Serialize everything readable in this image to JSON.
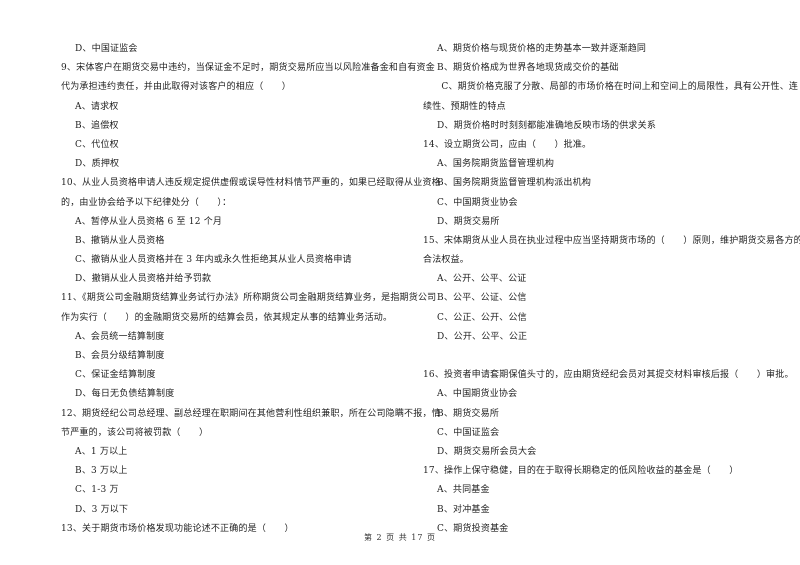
{
  "page": {
    "footer": "第 2 页 共 17 页"
  },
  "left_column": [
    {
      "type": "option",
      "text": "D、中国证监会"
    },
    {
      "type": "question",
      "number": "9",
      "lines": [
        "9、宋体客户在期货交易中违约，当保证金不足时，期货交易所应当以风险准备金和自有资金",
        "代为承担违约责任，并由此取得对该客户的相应（　　）"
      ]
    },
    {
      "type": "option",
      "text": "A、请求权"
    },
    {
      "type": "option",
      "text": "B、追偿权"
    },
    {
      "type": "option",
      "text": "C、代位权"
    },
    {
      "type": "option",
      "text": "D、质押权"
    },
    {
      "type": "question",
      "number": "10",
      "lines": [
        "10、从业人员资格申请人违反规定提供虚假或误导性材料情节严重的，如果已经取得从业资格",
        "的，由业协会给予以下纪律处分（　　）："
      ]
    },
    {
      "type": "option",
      "text": "A、暂停从业人员资格 6 至 12 个月"
    },
    {
      "type": "option",
      "text": "B、撤销从业人员资格"
    },
    {
      "type": "option",
      "text": "C、撤销从业人员资格并在 3 年内或永久性拒绝其从业人员资格申请"
    },
    {
      "type": "option",
      "text": "D、撤销从业人员资格并给予罚款"
    },
    {
      "type": "question",
      "number": "11",
      "lines": [
        "11、《期货公司金融期货结算业务试行办法》所称期货公司金融期货结算业务，是指期货公司",
        "作为实行（　　）的金融期货交易所的结算会员，依其规定从事的结算业务活动。"
      ]
    },
    {
      "type": "option",
      "text": "A、会员统一结算制度"
    },
    {
      "type": "option",
      "text": "B、会员分级结算制度"
    },
    {
      "type": "option",
      "text": "C、保证金结算制度"
    },
    {
      "type": "option",
      "text": "D、每日无负债结算制度"
    },
    {
      "type": "question",
      "number": "12",
      "lines": [
        "12、期货经纪公司总经理、副总经理在职期间在其他营利性组织兼职，所在公司隐瞒不报，情",
        "节严重的，该公司将被罚款（　　）"
      ]
    },
    {
      "type": "option",
      "text": "A、1 万以上"
    },
    {
      "type": "option",
      "text": "B、3 万以上"
    },
    {
      "type": "option",
      "text": "C、1-3 万"
    },
    {
      "type": "option",
      "text": "D、3 万以下"
    },
    {
      "type": "question",
      "number": "13",
      "lines": [
        "13、关于期货市场价格发现功能论述不正确的是（　　）"
      ]
    }
  ],
  "right_column": [
    {
      "type": "option",
      "text": "A、期货价格与现货价格的走势基本一致并逐渐趋同"
    },
    {
      "type": "option",
      "text": "B、期货价格成为世界各地现货成交价的基础"
    },
    {
      "type": "question_cont",
      "lines": [
        "　　C、期货价格克服了分散、局部的市场价格在时间上和空间上的局限性，具有公开性、连",
        "续性、预期性的特点"
      ]
    },
    {
      "type": "option",
      "text": "D、期货价格时时刻刻都能准确地反映市场的供求关系"
    },
    {
      "type": "question",
      "number": "14",
      "lines": [
        "14、设立期货公司，应由（　　）批准。"
      ]
    },
    {
      "type": "option",
      "text": "A、国务院期货监督管理机构"
    },
    {
      "type": "option",
      "text": "B、国务院期货监督管理机构派出机构"
    },
    {
      "type": "option",
      "text": "C、中国期货业协会"
    },
    {
      "type": "option",
      "text": "D、期货交易所"
    },
    {
      "type": "question",
      "number": "15",
      "lines": [
        "15、宋体期货从业人员在执业过程中应当坚持期货市场的（　　）原则，维护期货交易各方的",
        "合法权益。"
      ]
    },
    {
      "type": "option",
      "text": "A、公开、公平、公证"
    },
    {
      "type": "option",
      "text": "B、公平、公证、公信"
    },
    {
      "type": "option",
      "text": "C、公正、公开、公信"
    },
    {
      "type": "option",
      "text": "D、公开、公平、公正"
    },
    {
      "type": "gap"
    },
    {
      "type": "question",
      "number": "16",
      "lines": [
        "16、投资者申请套期保值头寸的，应由期货经纪会员对其提交材料审核后报（　　）审批。"
      ]
    },
    {
      "type": "option",
      "text": "A、中国期货业协会"
    },
    {
      "type": "option",
      "text": "B、期货交易所"
    },
    {
      "type": "option",
      "text": "C、中国证监会"
    },
    {
      "type": "option",
      "text": "D、期货交易所会员大会"
    },
    {
      "type": "question",
      "number": "17",
      "lines": [
        "17、操作上保守稳健，目的在于取得长期稳定的低风险收益的基金是（　　）"
      ]
    },
    {
      "type": "option",
      "text": "A、共同基金"
    },
    {
      "type": "option",
      "text": "B、对冲基金"
    },
    {
      "type": "option",
      "text": "C、期货投资基金"
    }
  ]
}
